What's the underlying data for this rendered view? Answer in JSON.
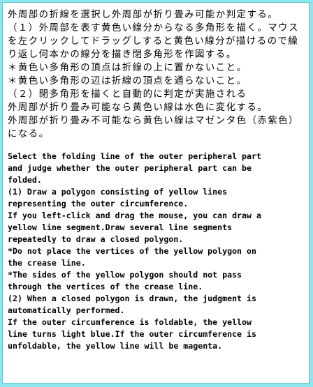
{
  "instructions": {
    "japanese": [
      "外周部の折線を選択し外周部が折り畳み可能か判定する。",
      "（１）外周部を表す黄色い線分からなる多角形を描く。マウスを左クリックしてドラッグしすると黄色い線分が描けるので繰り返し何本かの線分を描き閉多角形を作図する。",
      "＊黄色い多角形の頂点は折線の上に置かないこと。",
      "＊黄色い多角形の辺は折線の頂点を通らないこと。",
      "（２）閉多角形を描くと自動的に判定が実施される",
      "外周部が折り畳み可能なら黄色い線は水色に変化する。",
      "外周部が折り畳み不可能なら黄色い線はマゼンタ色（赤紫色）になる。"
    ],
    "english": [
      "Select the folding line of the outer peripheral part",
      "and judge whether the outer peripheral part can be",
      "folded.",
      "(1) Draw a polygon consisting of yellow lines",
      "representing the outer circumference.",
      "If you left-click and drag the mouse, you can draw a",
      "yellow line segment.Draw several line segments",
      "repeatedly to draw a closed polygon.",
      "*Do not place the vertices of the yellow polygon on",
      "the crease line.",
      "*The sides of the yellow polygon should not pass",
      "through the vertices of the crease line.",
      "(2) When a closed polygon is drawn, the judgment is",
      "automatically performed.",
      "If the outer circumference is foldable, the yellow",
      "line turns light blue.If the outer circumference is",
      "unfoldable, the yellow line will be magenta."
    ]
  },
  "colors": {
    "background": "#8fe6ef",
    "panel": "#ffffff",
    "text": "#000000"
  }
}
